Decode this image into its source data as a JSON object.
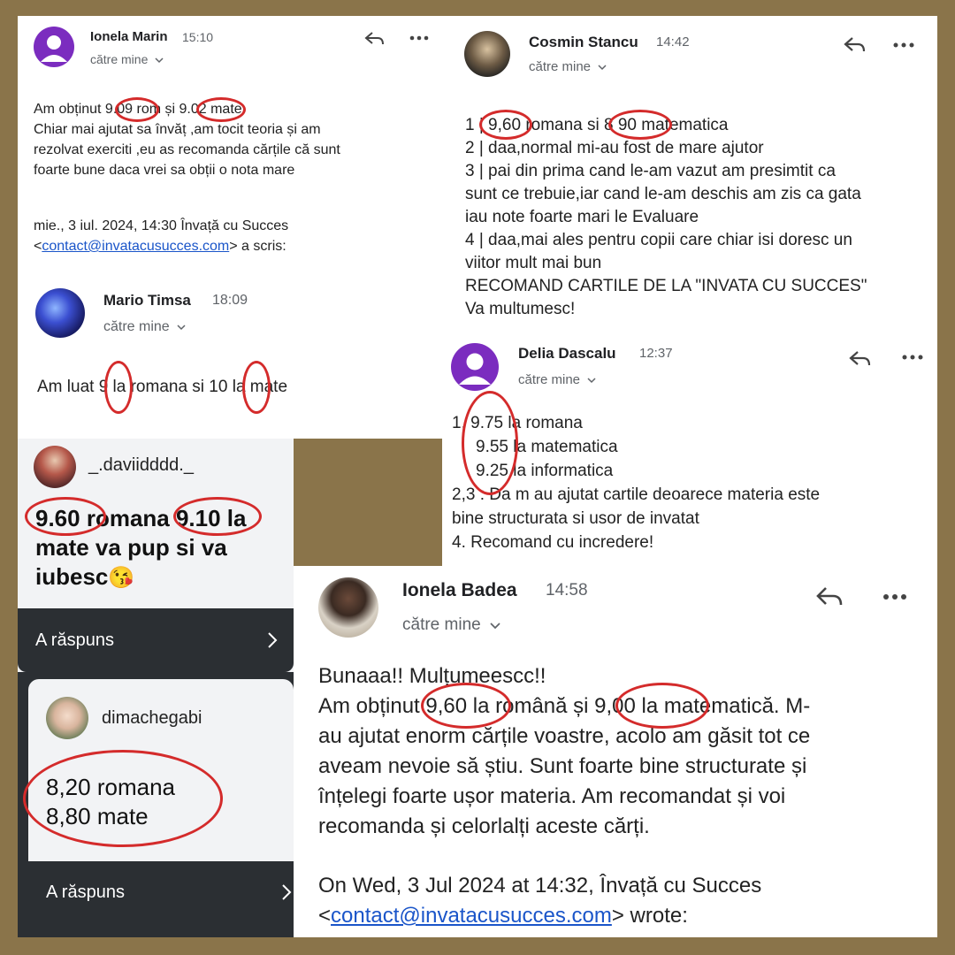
{
  "panel1": {
    "name": "Ionela Marin",
    "time": "15:10",
    "recipient": "către mine",
    "lines": [
      "Am obținut 9.09 rom și 9.02 mate",
      "Chiar mai ajutat sa învăț ,am tocit teoria și am",
      "rezolvat exerciti ,eu as recomanda cărțile că sunt",
      "foarte bune daca vrei sa obții o nota mare"
    ],
    "quote_line1": "mie., 3 iul. 2024, 14:30 Învață cu Succes",
    "quote_open": "<",
    "quote_email": "contact@invatacusucces.com",
    "quote_close": "> a scris:"
  },
  "panel2": {
    "name": "Mario Timsa",
    "time": "18:09",
    "recipient": "către mine",
    "text": "Am luat 9  la romana si 10 la mate"
  },
  "panel3": {
    "username": "_.daviidddd._",
    "line1": "9.60 romana 9.10 la",
    "line2": "mate va pup si va",
    "line3": "iubesc",
    "emoji": "😘",
    "reply_label": "A răspuns"
  },
  "panel4": {
    "username": "dimachegabi",
    "line1": "8,20 romana",
    "line2": "8,80 mate",
    "reply_label": "A răspuns"
  },
  "panel5": {
    "name": "Cosmin Stancu",
    "time": "14:42",
    "recipient": "către mine",
    "lines": [
      "1 | 9,60 romana si 8 90 matematica",
      "2 | daa,normal mi-au fost de mare ajutor",
      "3 | pai din prima cand le-am vazut am presimtit ca",
      "sunt ce trebuie,iar cand le-am deschis am zis ca gata",
      "iau note foarte mari le Evaluare",
      "4 | daa,mai ales pentru copii care chiar isi doresc un",
      "viitor mult mai bun",
      "RECOMAND CARTILE DE LA \"INVATA CU SUCCES\"",
      "Va multumesc!"
    ]
  },
  "panel6": {
    "name": "Delia Dascalu",
    "time": "12:37",
    "recipient": "către mine",
    "lines": [
      "1. 9.75 la romana",
      "9.55 la matematica",
      "9.25 la informatica",
      "2,3 : Da m au ajutat cartile deoarece materia este",
      "bine structurata si usor de invatat",
      "4. Recomand cu incredere!"
    ]
  },
  "panel7": {
    "name": "Ionela Badea",
    "time": "14:58",
    "recipient": "către mine",
    "lines": [
      "Bunaaa!! Mulțumeescc!!",
      "Am obținut 9,60 la română și 9,00 la matematică. M-",
      "au ajutat enorm cărțile voastre, acolo am găsit tot ce",
      "aveam nevoie să știu. Sunt foarte bine structurate și",
      "înțelegi foarte ușor materia. Am recomandat și voi",
      "recomanda și celorlalți aceste cărți."
    ],
    "quote_line1": "On Wed, 3 Jul 2024 at 14:32, Învață cu Succes",
    "quote_open": "<",
    "quote_email": "contact@invatacusucces.com",
    "quote_close": "> wrote:"
  },
  "colors": {
    "frame": "#8a744a",
    "highlight_ring": "#d42b2b",
    "link": "#1a55c9",
    "reply_bar": "#2b2f33",
    "avatar_default": "#7b2cbf"
  },
  "icons": [
    "reply-icon",
    "more-icon",
    "chevron-down-icon",
    "chevron-right-icon",
    "person-icon"
  ]
}
